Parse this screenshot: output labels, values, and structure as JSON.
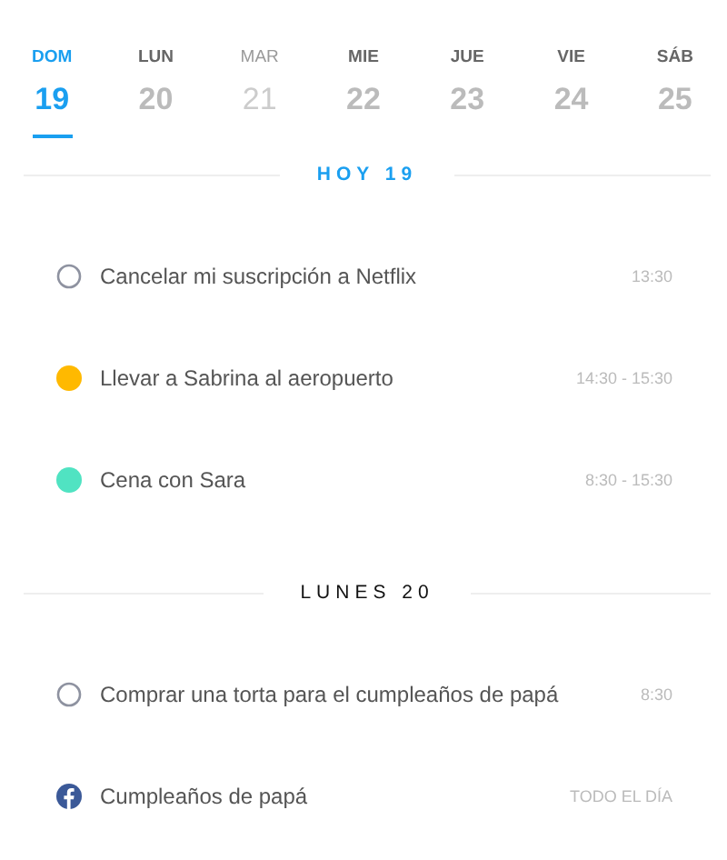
{
  "days": [
    {
      "label": "DOM",
      "number": "19",
      "selected": true,
      "dimmed": false
    },
    {
      "label": "LUN",
      "number": "20",
      "selected": false,
      "dimmed": false
    },
    {
      "label": "MAR",
      "number": "21",
      "selected": false,
      "dimmed": true
    },
    {
      "label": "MIE",
      "number": "22",
      "selected": false,
      "dimmed": false
    },
    {
      "label": "JUE",
      "number": "23",
      "selected": false,
      "dimmed": false
    },
    {
      "label": "VIE",
      "number": "24",
      "selected": false,
      "dimmed": false
    },
    {
      "label": "SÁB",
      "number": "25",
      "selected": false,
      "dimmed": false
    }
  ],
  "sections": [
    {
      "title": "HOY 19",
      "today": true,
      "items": [
        {
          "kind": "task",
          "title": "Cancelar mi suscripción a Netflix",
          "time": "13:30"
        },
        {
          "kind": "event",
          "color": "#ffb900",
          "title": "Llevar a Sabrina al aeropuerto",
          "time": "14:30 - 15:30"
        },
        {
          "kind": "event",
          "color": "#50e3c2",
          "title": "Cena con Sara",
          "time": "8:30 - 15:30"
        }
      ]
    },
    {
      "title": "LUNES 20",
      "today": false,
      "items": [
        {
          "kind": "task",
          "title": "Comprar una torta para el cumpleaños de papá",
          "time": "8:30"
        },
        {
          "kind": "facebook",
          "title": "Cumpleaños de papá",
          "time": "TODO EL DÍA"
        }
      ]
    }
  ]
}
